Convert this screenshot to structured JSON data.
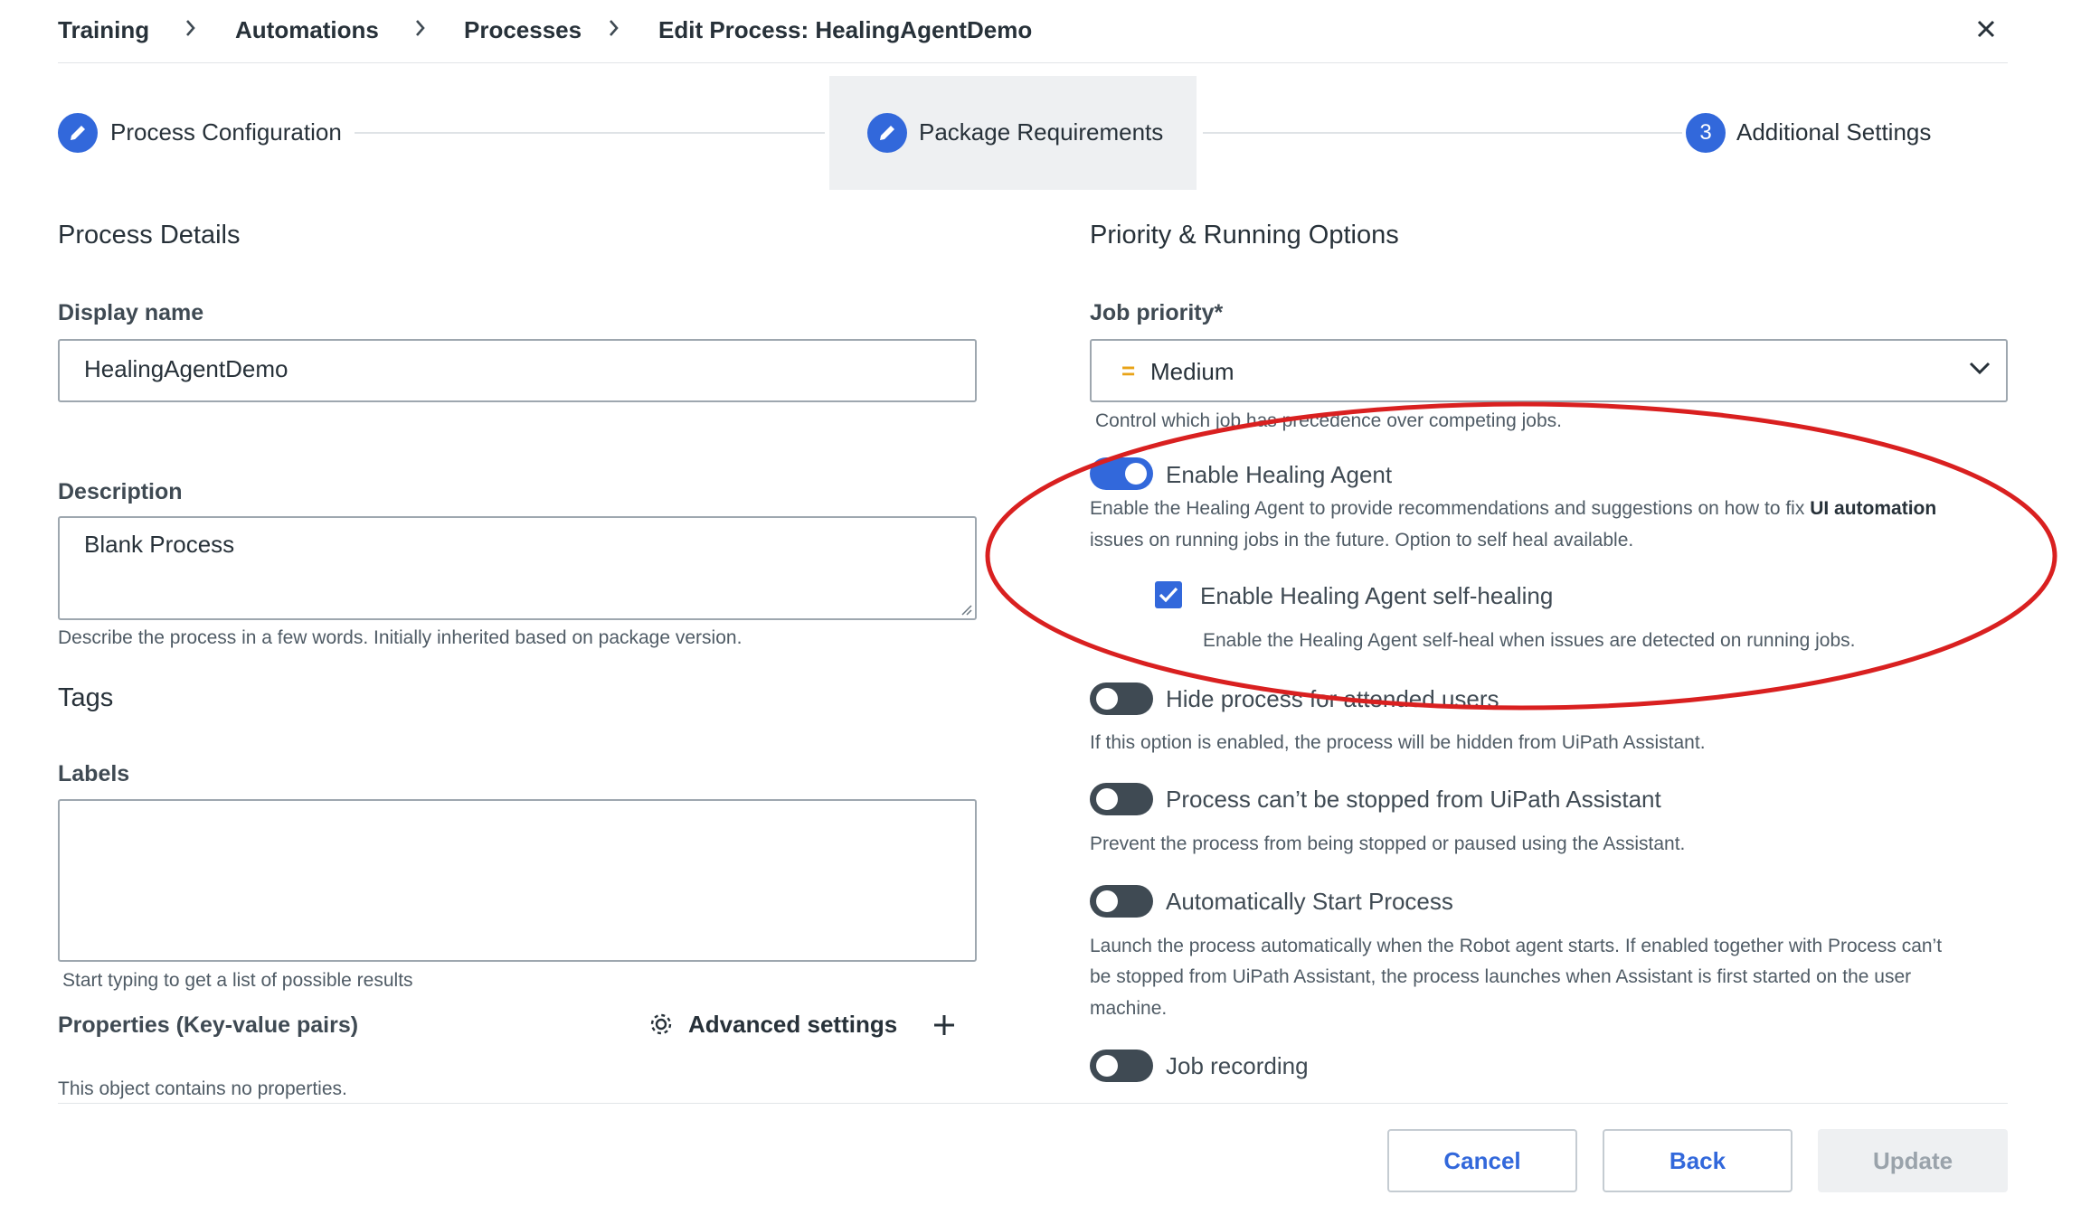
{
  "breadcrumb": {
    "items": [
      "Training",
      "Automations",
      "Processes"
    ],
    "current": "Edit Process: HealingAgentDemo"
  },
  "stepper": {
    "steps": [
      {
        "label": "Process Configuration",
        "marker": "pencil-icon"
      },
      {
        "label": "Package Requirements",
        "marker": "pencil-icon"
      },
      {
        "label": "Additional Settings",
        "number": "3"
      }
    ]
  },
  "details": {
    "title": "Process Details",
    "display_name_label": "Display name",
    "display_name_value": "HealingAgentDemo",
    "description_label": "Description",
    "description_value": "Blank Process",
    "description_help": "Describe the process in a few words. Initially inherited based on package version."
  },
  "tags": {
    "title": "Tags",
    "labels_label": "Labels",
    "labels_help": "Start typing to get a list of possible results",
    "properties_label": "Properties (Key-value pairs)",
    "advanced_settings": "Advanced settings",
    "no_properties": "This object contains no properties."
  },
  "priority": {
    "title": "Priority & Running Options",
    "job_priority_label": "Job priority*",
    "job_priority_value": "Medium",
    "job_priority_symbol": "=",
    "job_priority_help": "Control which job has precedence over competing jobs."
  },
  "options": {
    "healing_agent": {
      "label": "Enable Healing Agent",
      "enabled": true,
      "help_1": "Enable the Healing Agent to provide recommendations and suggestions on how to fix ",
      "help_bold": "UI automation",
      "help_2": "issues on running jobs in the future. Option to self heal available."
    },
    "self_healing": {
      "label": "Enable Healing Agent self-healing",
      "checked": true,
      "help": "Enable the Healing Agent self-heal when issues are detected on running jobs."
    },
    "hide_process": {
      "label": "Hide process for attended users",
      "enabled": false,
      "help": "If this option is enabled, the process will be hidden from UiPath Assistant."
    },
    "cannot_stop": {
      "label": "Process can’t be stopped from UiPath Assistant",
      "enabled": false,
      "help": "Prevent the process from being stopped or paused using the Assistant."
    },
    "auto_start": {
      "label": "Automatically Start Process",
      "enabled": false,
      "help_1": "Launch the process automatically when the Robot agent starts. If enabled together with Process can’t",
      "help_2": "be stopped from UiPath Assistant, the process launches when Assistant is first started on the user",
      "help_3": "machine."
    },
    "job_recording": {
      "label": "Job recording",
      "enabled": false
    }
  },
  "footer": {
    "cancel": "Cancel",
    "back": "Back",
    "update": "Update"
  },
  "colors": {
    "accent": "#3268db",
    "annotation": "#d92020",
    "priority_medium": "#e8a317"
  }
}
